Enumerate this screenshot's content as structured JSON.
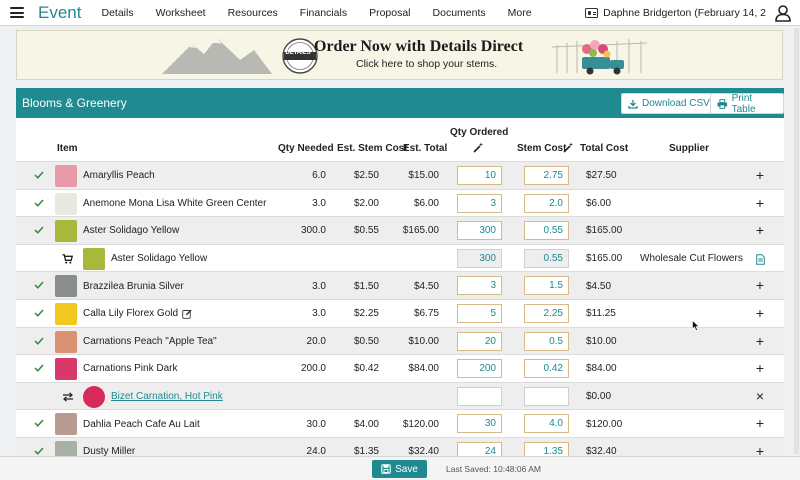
{
  "nav": {
    "brand": "Event",
    "items": [
      "Details",
      "Worksheet",
      "Resources",
      "Financials",
      "Proposal",
      "Documents",
      "More"
    ],
    "user": "Daphne Bridgerton (February 14, 2"
  },
  "banner": {
    "title": "Order Now with Details Direct",
    "subtitle": "Click here to shop your stems.",
    "badge": "DETAILS"
  },
  "section": {
    "title": "Blooms & Greenery",
    "download_label": "Download CSV",
    "print_label": "Print Table"
  },
  "table": {
    "headers": {
      "item": "Item",
      "qty_needed": "Qty Needed",
      "est_stem_cost": "Est. Stem Cost",
      "est_total": "Est. Total",
      "qty_ordered": "Qty Ordered",
      "stem_cost": "Stem Cost",
      "total_cost": "Total Cost",
      "supplier": "Supplier"
    },
    "rows": [
      {
        "kind": "item",
        "name": "Amaryllis Peach",
        "qty": "6.0",
        "est_stem": "$2.50",
        "est_total": "$15.00",
        "qty_ordered": "10",
        "stem_cost": "2.75",
        "total": "$27.50",
        "supplier": "",
        "thumb": "#e89aa8",
        "action": "+"
      },
      {
        "kind": "item",
        "name": "Anemone Mona Lisa White Green Center",
        "qty": "3.0",
        "est_stem": "$2.00",
        "est_total": "$6.00",
        "qty_ordered": "3",
        "stem_cost": "2.0",
        "total": "$6.00",
        "supplier": "",
        "thumb": "#e8e8e0",
        "action": "+"
      },
      {
        "kind": "item",
        "name": "Aster Solidago Yellow",
        "qty": "300.0",
        "est_stem": "$0.55",
        "est_total": "$165.00",
        "qty_ordered": "300",
        "stem_cost": "0.55",
        "total": "$165.00",
        "supplier": "",
        "thumb": "#a8b83a",
        "action": "+"
      },
      {
        "kind": "order",
        "name": "Aster Solidago Yellow",
        "qty": "",
        "est_stem": "",
        "est_total": "",
        "qty_ordered": "300",
        "stem_cost": "0.55",
        "total": "$165.00",
        "supplier": "Wholesale Cut Flowers",
        "thumb": "#a8b83a",
        "action": ""
      },
      {
        "kind": "item",
        "name": "Brazzilea Brunia Silver",
        "qty": "3.0",
        "est_stem": "$1.50",
        "est_total": "$4.50",
        "qty_ordered": "3",
        "stem_cost": "1.5",
        "total": "$4.50",
        "supplier": "",
        "thumb": "#8a8f8c",
        "action": "+"
      },
      {
        "kind": "item",
        "name": "Calla Lily Florex Gold",
        "qty": "3.0",
        "est_stem": "$2.25",
        "est_total": "$6.75",
        "qty_ordered": "5",
        "stem_cost": "2.25",
        "total": "$11.25",
        "supplier": "",
        "thumb": "#f0c820",
        "action": "+"
      },
      {
        "kind": "item",
        "name": "Carnations Peach \"Apple Tea\"",
        "qty": "20.0",
        "est_stem": "$0.50",
        "est_total": "$10.00",
        "qty_ordered": "20",
        "stem_cost": "0.5",
        "total": "$10.00",
        "supplier": "",
        "thumb": "#d99272",
        "action": "+"
      },
      {
        "kind": "item",
        "name": "Carnations Pink Dark",
        "qty": "200.0",
        "est_stem": "$0.42",
        "est_total": "$84.00",
        "qty_ordered": "200",
        "stem_cost": "0.42",
        "total": "$84.00",
        "supplier": "",
        "thumb": "#d8386a",
        "action": "+"
      },
      {
        "kind": "sub",
        "name": "Bizet Carnation, Hot Pink",
        "qty": "",
        "est_stem": "",
        "est_total": "",
        "qty_ordered": "",
        "stem_cost": "",
        "total": "$0.00",
        "supplier": "",
        "thumb": "#d62a5a",
        "action": "×"
      },
      {
        "kind": "item",
        "name": "Dahlia Peach Cafe Au Lait",
        "qty": "30.0",
        "est_stem": "$4.00",
        "est_total": "$120.00",
        "qty_ordered": "30",
        "stem_cost": "4.0",
        "total": "$120.00",
        "supplier": "",
        "thumb": "#b89a90",
        "action": "+"
      },
      {
        "kind": "item",
        "name": "Dusty Miller",
        "qty": "24.0",
        "est_stem": "$1.35",
        "est_total": "$32.40",
        "qty_ordered": "24",
        "stem_cost": "1.35",
        "total": "$32.40",
        "supplier": "",
        "thumb": "#a9b0a6",
        "action": "+"
      }
    ]
  },
  "footer": {
    "save_label": "Save",
    "last_saved": "Last Saved: 10:48:06 AM"
  },
  "colors": {
    "accent": "#1f8a8f",
    "input_border": "#d7b98c"
  }
}
